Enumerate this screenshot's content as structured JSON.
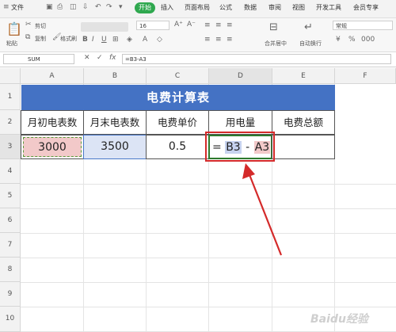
{
  "menu": {
    "file": "文件",
    "start": "开始",
    "insert": "插入",
    "layout": "页面布局",
    "formula": "公式",
    "data": "数据",
    "review": "审阅",
    "view": "视图",
    "dev": "开发工具",
    "member": "会员专享"
  },
  "ribbon": {
    "paste": "粘贴",
    "cut": "剪切",
    "copy": "复制",
    "format_painter": "格式刷",
    "font_size": "16",
    "merge": "合并居中",
    "wrap": "自动换行",
    "number_format": "常规"
  },
  "formula_bar": {
    "name_box": "SUM",
    "formula": "=B3-A3"
  },
  "columns": [
    "A",
    "B",
    "C",
    "D",
    "E",
    "F"
  ],
  "rows": [
    "1",
    "2",
    "3",
    "4",
    "5",
    "6",
    "7",
    "8",
    "9",
    "10"
  ],
  "sheet": {
    "title": "电费计算表",
    "headers": [
      "月初电表数",
      "月末电表数",
      "电费单价",
      "用电量",
      "电费总额"
    ],
    "row3": {
      "a": "3000",
      "b": "3500",
      "c": "0.5",
      "d_eq": "=",
      "d_ref1": "B3",
      "d_op": "-",
      "d_ref2": "A3",
      "e": ""
    }
  },
  "watermark": "Baidu经验",
  "colors": {
    "title_bg": "#4472c4",
    "a3_bg": "#f2c9c9",
    "b3_bg": "#dce4f5",
    "highlight_box": "#d42a2a",
    "accent_green": "#2fa84f"
  }
}
